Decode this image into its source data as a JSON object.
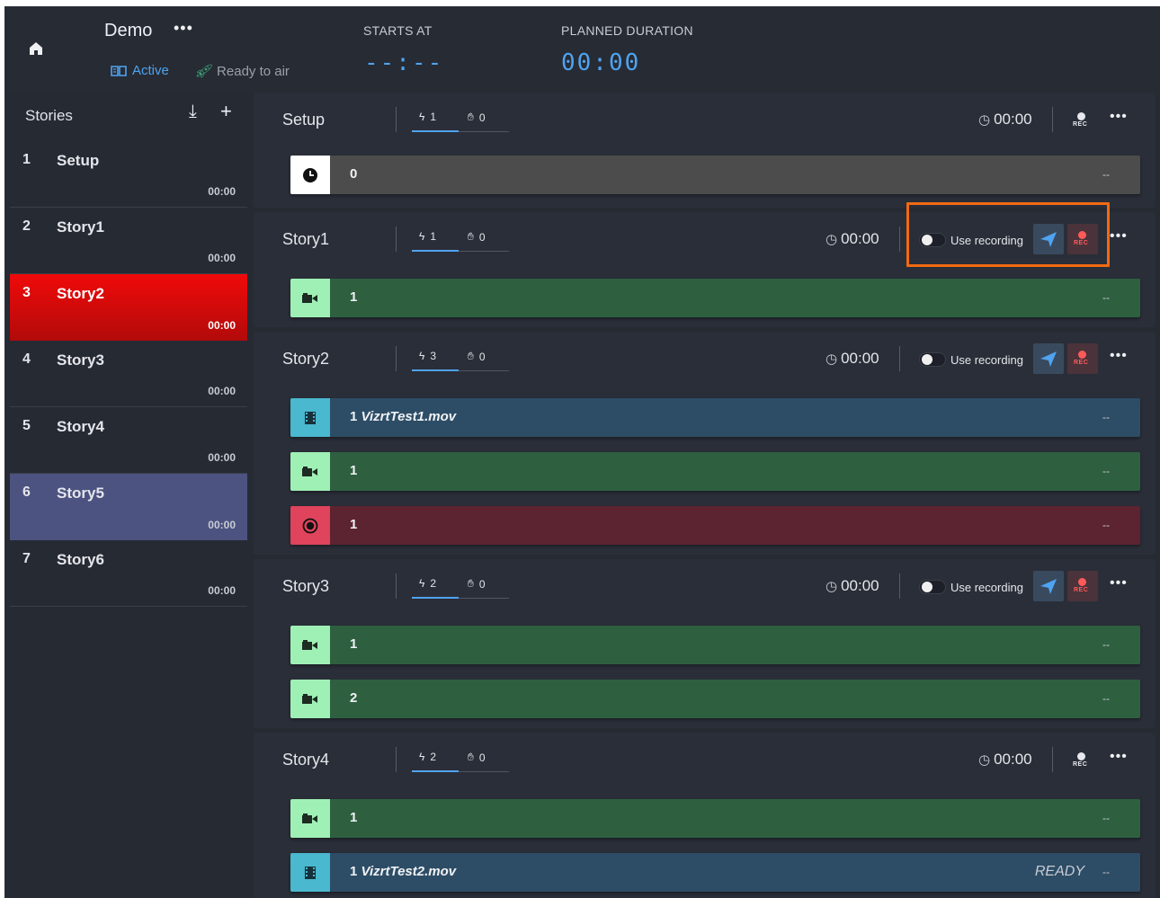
{
  "rundown": {
    "title": "Demo",
    "more_label": "•••",
    "status_active": "Active",
    "status_ready": "Ready to air",
    "starts_at_label": "STARTS AT",
    "starts_at_value": "--:--",
    "planned_duration_label": "PLANNED DURATION",
    "planned_duration_value": "00:00"
  },
  "sidebar": {
    "title": "Stories",
    "download_icon": "download-icon",
    "add_icon": "plus-icon",
    "items": [
      {
        "num": "1",
        "name": "Setup",
        "duration": "00:00",
        "state": "normal"
      },
      {
        "num": "2",
        "name": "Story1",
        "duration": "00:00",
        "state": "normal"
      },
      {
        "num": "3",
        "name": "Story2",
        "duration": "00:00",
        "state": "on-air"
      },
      {
        "num": "4",
        "name": "Story3",
        "duration": "00:00",
        "state": "normal"
      },
      {
        "num": "5",
        "name": "Story4",
        "duration": "00:00",
        "state": "normal"
      },
      {
        "num": "6",
        "name": "Story5",
        "duration": "00:00",
        "state": "selected"
      },
      {
        "num": "7",
        "name": "Story6",
        "duration": "00:00",
        "state": "normal"
      }
    ]
  },
  "stories": [
    {
      "name": "Setup",
      "actions_count": "1",
      "manual_count": "0",
      "duration": "00:00",
      "use_recording": false,
      "rows": [
        {
          "icon": "clock-icon",
          "label": "0",
          "status": "--",
          "color": "grey"
        }
      ]
    },
    {
      "name": "Story1",
      "actions_count": "1",
      "manual_count": "0",
      "duration": "00:00",
      "use_recording": true,
      "use_recording_label": "Use recording",
      "rows": [
        {
          "icon": "camera-icon",
          "label": "1",
          "status": "--",
          "color": "green"
        }
      ]
    },
    {
      "name": "Story2",
      "actions_count": "3",
      "manual_count": "0",
      "duration": "00:00",
      "use_recording": true,
      "use_recording_label": "Use recording",
      "rows": [
        {
          "icon": "film-icon",
          "label_num": "1",
          "label_clip": "VizrtTest1.mov",
          "status": "--",
          "color": "blue"
        },
        {
          "icon": "camera-icon",
          "label": "1",
          "status": "--",
          "color": "green"
        },
        {
          "icon": "record-icon",
          "label": "1",
          "status": "--",
          "color": "red"
        }
      ]
    },
    {
      "name": "Story3",
      "actions_count": "2",
      "manual_count": "0",
      "duration": "00:00",
      "use_recording": true,
      "use_recording_label": "Use recording",
      "rows": [
        {
          "icon": "camera-icon",
          "label": "1",
          "status": "--",
          "color": "green"
        },
        {
          "icon": "camera-icon",
          "label": "2",
          "status": "--",
          "color": "green"
        }
      ]
    },
    {
      "name": "Story4",
      "actions_count": "2",
      "manual_count": "0",
      "duration": "00:00",
      "use_recording": false,
      "rows": [
        {
          "icon": "camera-icon",
          "label": "1",
          "status": "--",
          "color": "green"
        },
        {
          "icon": "film-icon",
          "label_num": "1",
          "label_clip": "VizrtTest2.mov",
          "ready": "READY",
          "status": "--",
          "color": "blue"
        }
      ]
    }
  ],
  "rec_label": "REC",
  "colors": {
    "accent": "#4fa3f0",
    "on_air": "#f00a0a",
    "selected": "#4c5380",
    "highlight": "#f26a12",
    "green_row": "#2e6040",
    "blue_row": "#2d4d66",
    "red_row": "#5b2430"
  }
}
